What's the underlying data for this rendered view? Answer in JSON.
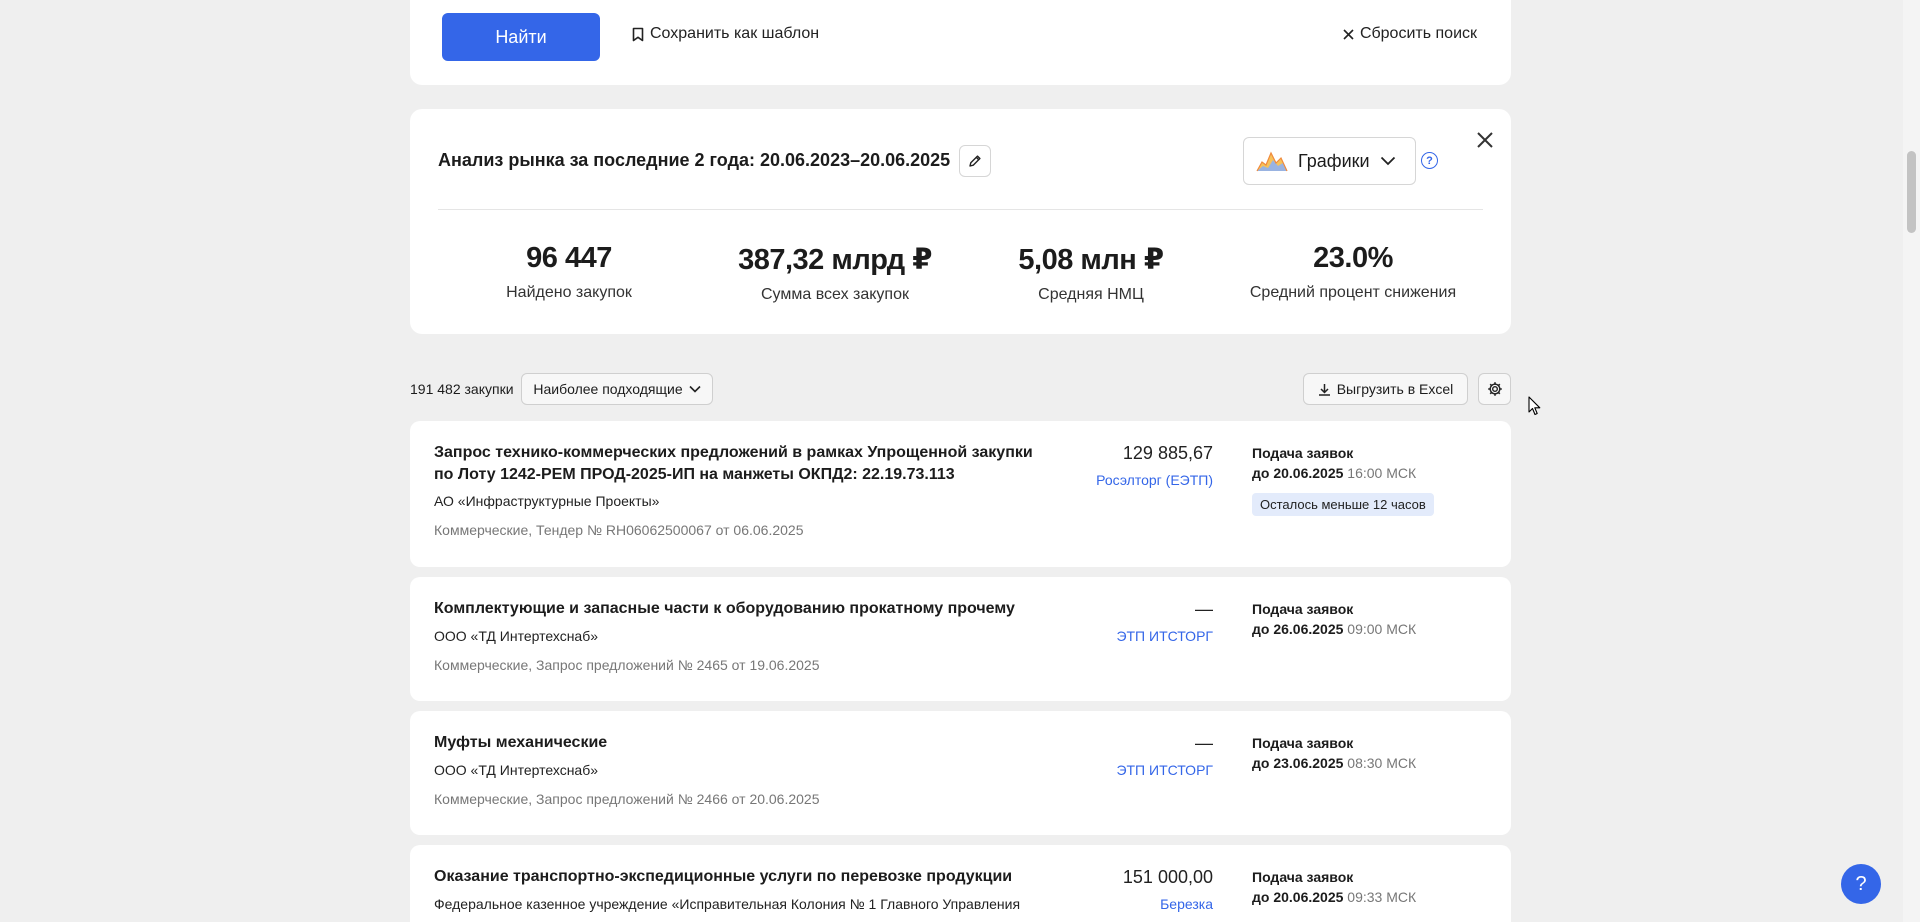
{
  "search": {
    "find_label": "Найти",
    "save_template_label": "Сохранить как шаблон",
    "reset_label": "Сбросить поиск"
  },
  "analytics": {
    "title": "Анализ рынка за последние 2 года: 20.06.2023–20.06.2025",
    "charts_label": "Графики",
    "stats": [
      {
        "value": "96 447",
        "caption": "Найдено закупок"
      },
      {
        "value": "387,32 млрд ₽",
        "caption": "Сумма всех закупок"
      },
      {
        "value": "5,08 млн ₽",
        "caption": "Средняя НМЦ"
      },
      {
        "value": "23.0%",
        "caption": "Средний процент снижения"
      }
    ]
  },
  "list": {
    "count": "191 482 закупки",
    "sort_label": "Наиболее подходящие",
    "excel_label": "Выгрузить в Excel"
  },
  "tenders": [
    {
      "title": "Запрос технико-коммерческих предложений в рамках Упрощенной закупки по Лоту 1242-РЕМ ПРОД-2025-ИП на манжеты ОКПД2: 22.19.73.113",
      "org": "АО «Инфраструктурные Проекты»",
      "meta": "Коммерческие, Тендер № RH06062500067 от 06.06.2025",
      "price": "129 885,67",
      "platform": "Росэлторг (ЕЭТП)",
      "deadline_label": "Подача заявок",
      "deadline_date": "до 20.06.2025",
      "deadline_time": "16:00 МСК",
      "badge": "Осталось меньше 12 часов"
    },
    {
      "title": "Комплектующие и запасные части к оборудованию прокатному прочему",
      "org": "ООО «ТД Интертехснаб»",
      "meta": "Коммерческие, Запрос предложений № 2465 от 19.06.2025",
      "price": "—",
      "platform": "ЭТП ИТСТОРГ",
      "deadline_label": "Подача заявок",
      "deadline_date": "до 26.06.2025",
      "deadline_time": "09:00 МСК"
    },
    {
      "title": "Муфты механические",
      "org": "ООО «ТД Интертехснаб»",
      "meta": "Коммерческие, Запрос предложений № 2466 от 20.06.2025",
      "price": "—",
      "platform": "ЭТП ИТСТОРГ",
      "deadline_label": "Подача заявок",
      "deadline_date": "до 23.06.2025",
      "deadline_time": "08:30 МСК"
    },
    {
      "title": "Оказание транспортно-экспедиционные услуги по перевозке продукции",
      "org": "Федеральное казенное учреждение «Исправительная Колония № 1 Главного Управления",
      "price": "151 000,00",
      "platform": "Березка",
      "deadline_label": "Подача заявок",
      "deadline_date": "до 20.06.2025",
      "deadline_time": "09:33 МСК"
    }
  ],
  "help_fab_label": "?"
}
